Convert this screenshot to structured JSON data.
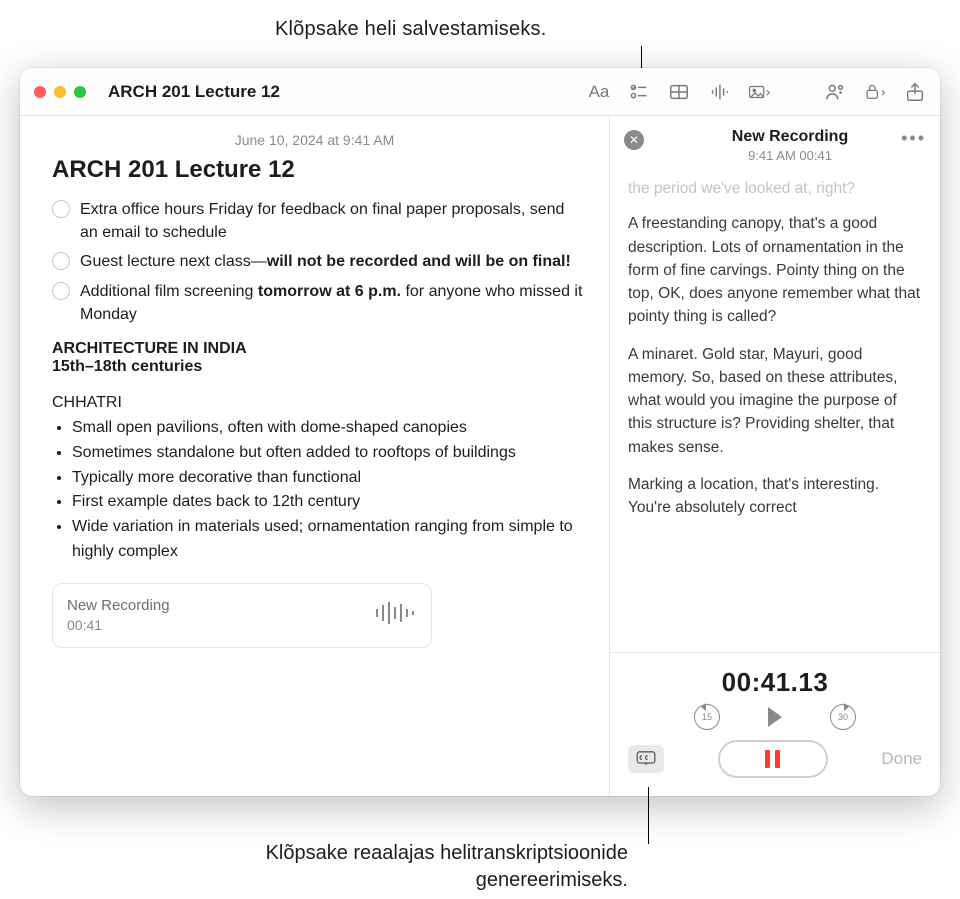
{
  "callouts": {
    "top": "Klõpsake heli salvestamiseks.",
    "bottom_line1": "Klõpsake reaalajas helitranskriptsioonide",
    "bottom_line2": "genereerimiseks."
  },
  "window": {
    "title": "ARCH 201 Lecture 12",
    "toolbar_icons": {
      "format": "Aa",
      "checklist": "checklist-icon",
      "table": "table-icon",
      "audio": "audio-icon",
      "media": "media-icon",
      "link": "link-icon",
      "lock": "lock-icon",
      "share": "share-icon"
    }
  },
  "note": {
    "date": "June 10, 2024 at 9:41 AM",
    "title": "ARCH 201 Lecture 12",
    "checklist": [
      {
        "pre": "Extra office hours Friday for feedback on final paper proposals, send an email to schedule",
        "bold": "",
        "post": ""
      },
      {
        "pre": "Guest lecture next class—",
        "bold": "will not be recorded and will be on final!",
        "post": ""
      },
      {
        "pre": "Additional film screening ",
        "bold": "tomorrow at 6 p.m.",
        "post": " for anyone who missed it Monday"
      }
    ],
    "section_heading1": "ARCHITECTURE IN INDIA",
    "section_heading2": "15th–18th centuries",
    "subhead": "CHHATRI",
    "bullets": [
      "Small open pavilions, often with dome-shaped canopies",
      "Sometimes standalone but often added to rooftops of buildings",
      "Typically more decorative than functional",
      "First example dates back to 12th century",
      "Wide variation in materials used; ornamentation ranging from simple to highly complex"
    ],
    "embed": {
      "title": "New Recording",
      "time": "00:41"
    }
  },
  "recording_panel": {
    "title": "New Recording",
    "subtitle": "9:41 AM 00:41",
    "transcript_faded": "the period we've looked at, right?",
    "transcript": [
      "A freestanding canopy, that's a good description. Lots of ornamentation in the form of fine carvings. Pointy thing on the top, OK, does anyone remember what that pointy thing is called?",
      "A minaret. Gold star, Mayuri, good memory. So, based on these attributes, what would you imagine the purpose of this structure is? Providing shelter, that makes sense.",
      "Marking a location, that's interesting. You're absolutely correct"
    ],
    "timer": "00:41.13",
    "skip_back": "15",
    "skip_fwd": "30",
    "done": "Done"
  }
}
